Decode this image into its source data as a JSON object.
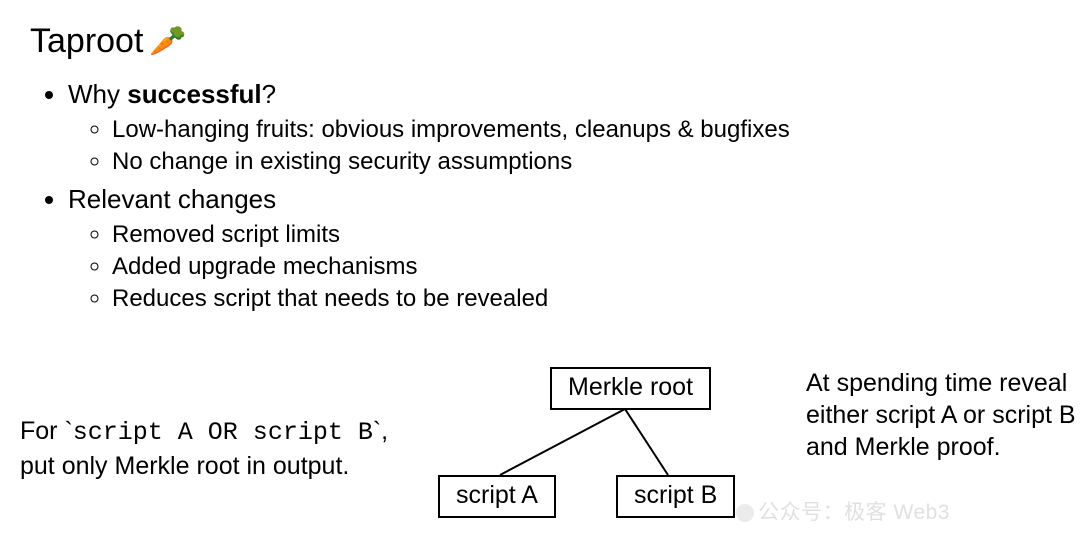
{
  "title": "Taproot",
  "emoji": "🥕",
  "bullets": {
    "one": {
      "prefix": "Why ",
      "strong": "successful",
      "suffix": "?"
    },
    "one_sub": [
      "Low-hanging fruits: obvious improvements, cleanups & bugfixes",
      "No change in existing security assumptions"
    ],
    "two": "Relevant changes",
    "two_sub": [
      "Removed script limits",
      "Added upgrade mechanisms",
      "Reduces script that needs to be revealed"
    ]
  },
  "bottom": {
    "left_pre": "For `",
    "left_code": "script A OR script B",
    "left_post": "`, put only Merkle root in output.",
    "right": "At spending time reveal either script A or script B and Merkle proof."
  },
  "tree": {
    "root": "Merkle root",
    "leafA": "script A",
    "leafB": "script B"
  },
  "watermark": "公众号：极客 Web3"
}
